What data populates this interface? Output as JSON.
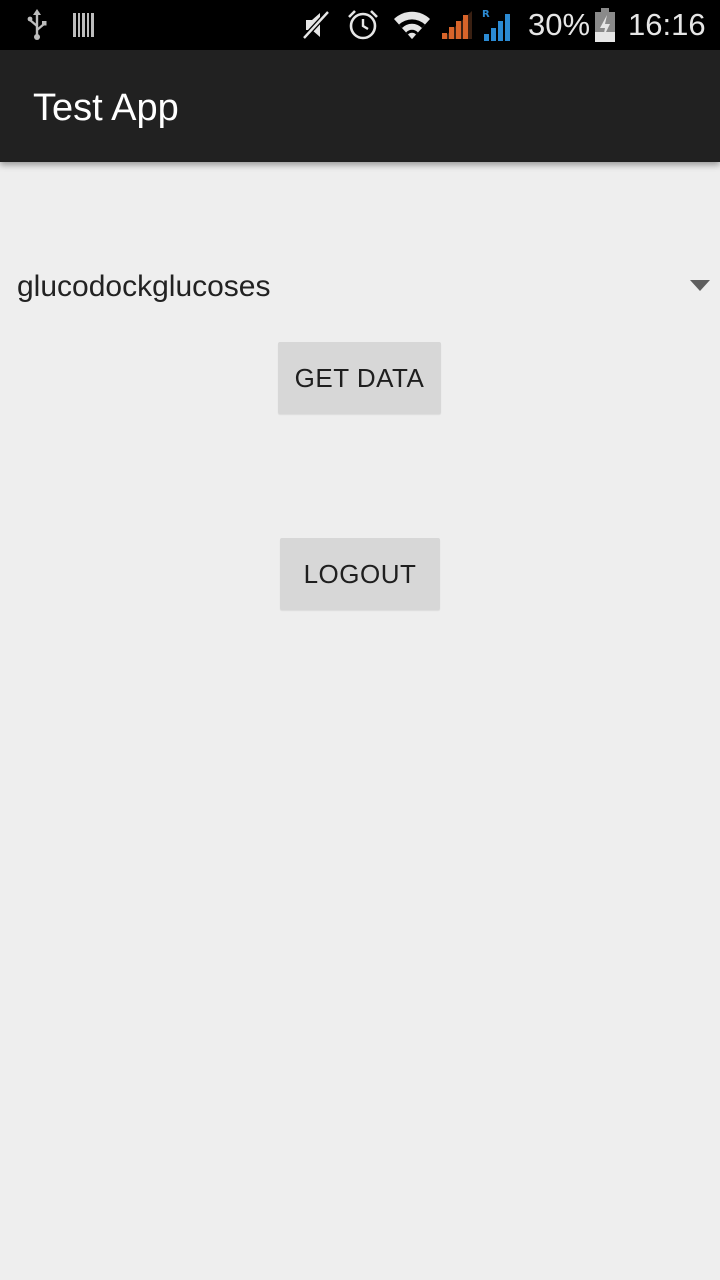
{
  "status_bar": {
    "battery": "30%",
    "time": "16:16",
    "icons": [
      "usb-icon",
      "barcode-icon",
      "mute-icon",
      "alarm-icon",
      "wifi-icon",
      "signal-orange-icon",
      "signal-blue-roaming-icon",
      "battery-charging-icon"
    ],
    "roaming_label": "R",
    "colors": {
      "signal_orange": "#d8642a",
      "signal_blue": "#2b8ad3"
    }
  },
  "action_bar": {
    "title": "Test App"
  },
  "spinner": {
    "selected": "glucodockglucoses",
    "arrow_icon": "dropdown-triangle-icon"
  },
  "buttons": {
    "get_data": "GET DATA",
    "logout": "LOGOUT"
  },
  "colors": {
    "background": "#eeeeee",
    "action_bar": "#212121",
    "button": "#d7d7d7"
  }
}
